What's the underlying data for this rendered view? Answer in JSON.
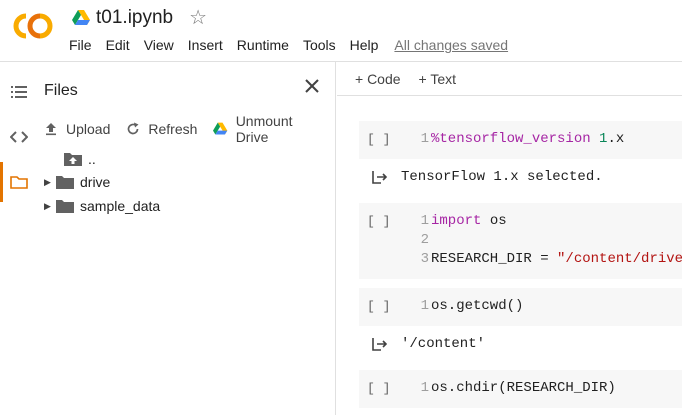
{
  "header": {
    "notebook_title": "t01.ipynb",
    "save_status": "All changes saved",
    "menu": [
      "File",
      "Edit",
      "View",
      "Insert",
      "Runtime",
      "Tools",
      "Help"
    ],
    "colors": {
      "logo": "#f9ab00",
      "rail_active": "#e37400"
    }
  },
  "files_panel": {
    "title": "Files",
    "actions": {
      "upload": "Upload",
      "refresh": "Refresh",
      "unmount": "Unmount Drive"
    },
    "tree": [
      {
        "label": "..",
        "icon": "folder-up-icon"
      },
      {
        "label": "drive",
        "icon": "folder-icon"
      },
      {
        "label": "sample_data",
        "icon": "folder-icon"
      }
    ]
  },
  "toolbar": {
    "add_code": "+ Code",
    "add_text": "+ Text"
  },
  "cells": [
    {
      "run": "[ ]",
      "lines": [
        {
          "n": "1",
          "parts": [
            {
              "t": "%tensorflow_version",
              "c": "kw"
            },
            {
              "t": " ",
              "c": "tx"
            },
            {
              "t": "1",
              "c": "num"
            },
            {
              "t": ".x",
              "c": "tx"
            }
          ]
        }
      ],
      "output": "TensorFlow 1.x selected."
    },
    {
      "run": "[ ]",
      "lines": [
        {
          "n": "1",
          "parts": [
            {
              "t": "import",
              "c": "kw"
            },
            {
              "t": " os",
              "c": "tx"
            }
          ]
        },
        {
          "n": "2",
          "parts": []
        },
        {
          "n": "3",
          "parts": [
            {
              "t": "RESEARCH_DIR = ",
              "c": "tx"
            },
            {
              "t": "\"/content/drive",
              "c": "str"
            }
          ]
        }
      ],
      "output": null
    },
    {
      "run": "[ ]",
      "lines": [
        {
          "n": "1",
          "parts": [
            {
              "t": "os.getcwd()",
              "c": "tx"
            }
          ]
        }
      ],
      "output": "'/content'"
    },
    {
      "run": "[ ]",
      "lines": [
        {
          "n": "1",
          "parts": [
            {
              "t": "os.chdir(RESEARCH_DIR)",
              "c": "tx"
            }
          ]
        }
      ],
      "output": null
    }
  ]
}
